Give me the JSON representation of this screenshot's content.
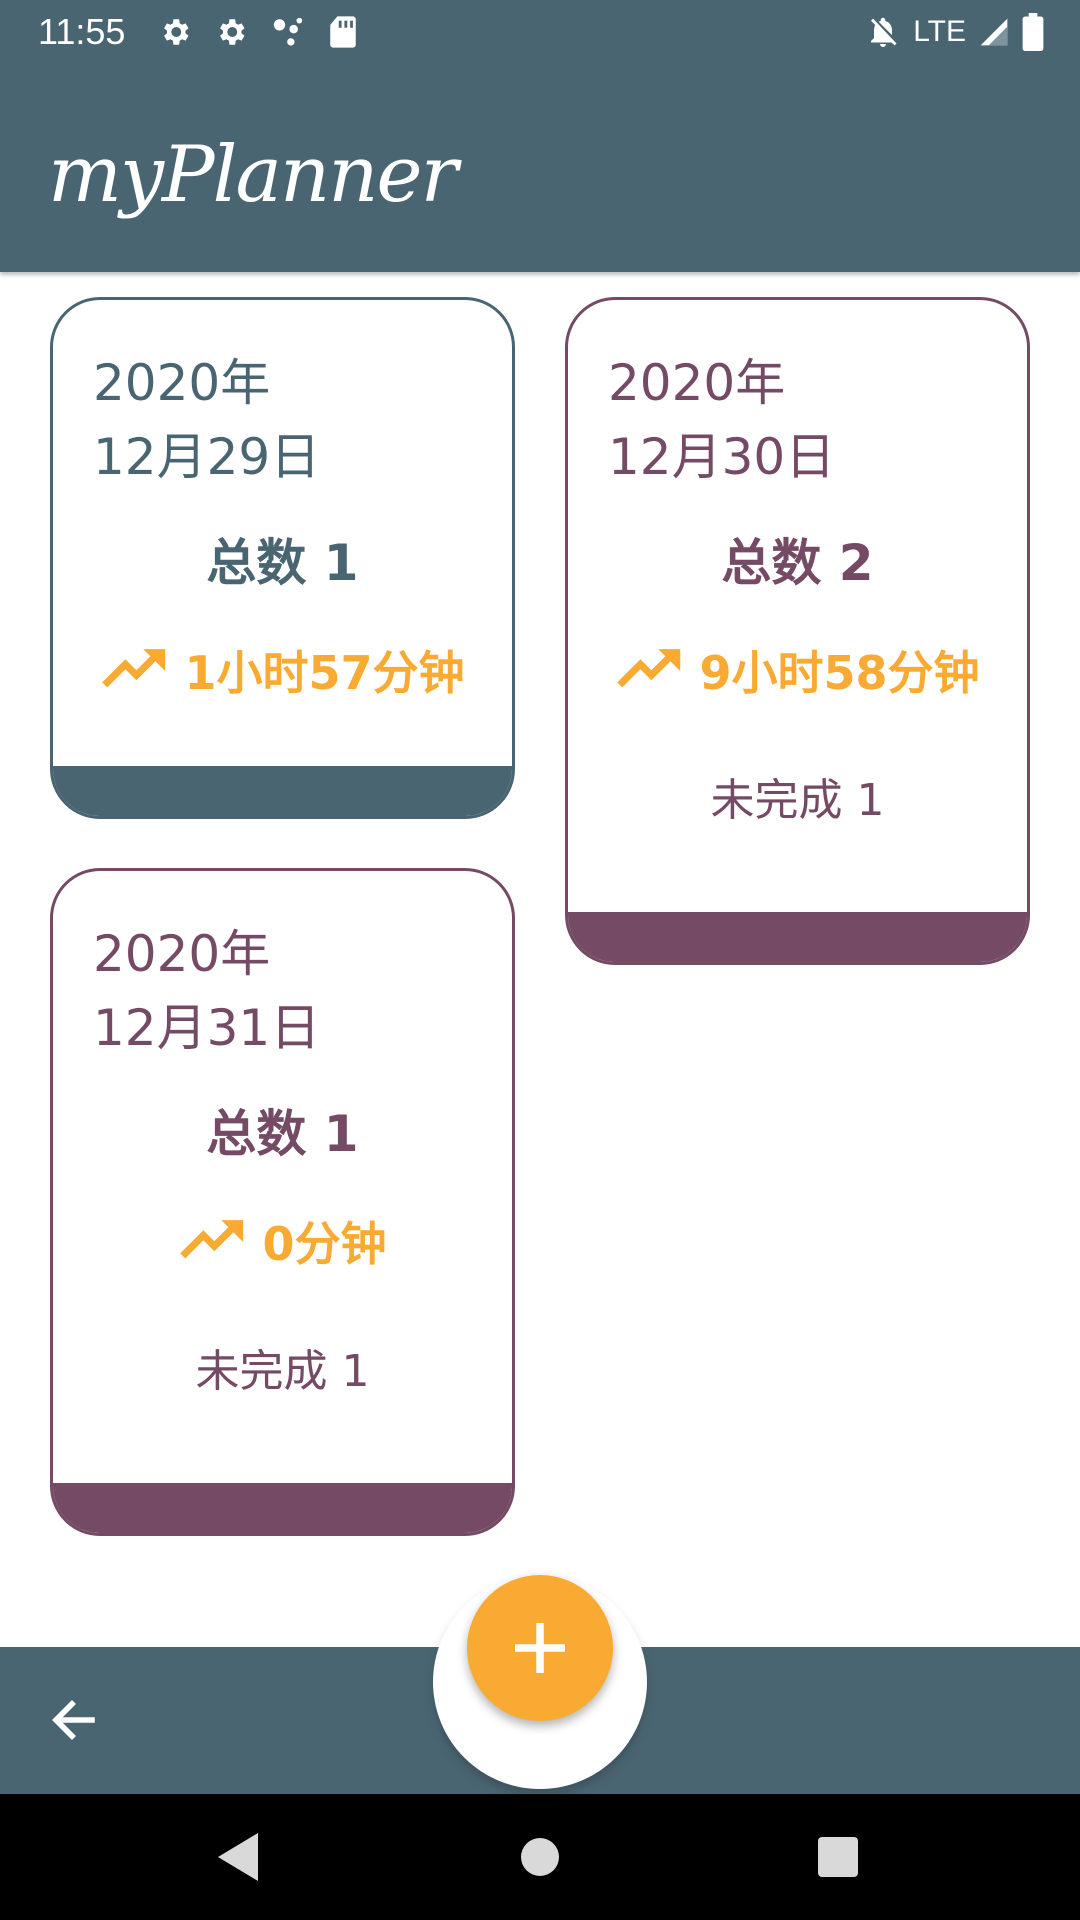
{
  "status_bar": {
    "time": "11:55",
    "network": "LTE",
    "icons_left": [
      "settings-icon",
      "settings-icon",
      "assistant-dots-icon",
      "sd-card-icon"
    ],
    "icons_right": [
      "notifications-off-icon",
      "signal-icon",
      "battery-icon"
    ]
  },
  "app_bar": {
    "title": "myPlanner"
  },
  "colors": {
    "primary": "#4a6572",
    "secondary": "#744a65",
    "accent": "#f9aa33",
    "background": "#ffffff"
  },
  "cards": [
    {
      "date_year": "2020年",
      "date_day": "12月29日",
      "total": "总数 1",
      "duration": "1小时57分钟",
      "incomplete": "",
      "color": "#4a6572"
    },
    {
      "date_year": "2020年",
      "date_day": "12月30日",
      "total": "总数 2",
      "duration": "9小时58分钟",
      "incomplete": "未完成 1",
      "color": "#744a65"
    },
    {
      "date_year": "2020年",
      "date_day": "12月31日",
      "total": "总数 1",
      "duration": "0分钟",
      "incomplete": "未完成 1",
      "color": "#744a65"
    }
  ],
  "bottom_bar": {
    "back_icon": "arrow-back-icon",
    "fab_icon": "add-icon"
  },
  "nav_bar": {
    "icons": [
      "nav-back-icon",
      "nav-home-icon",
      "nav-recents-icon"
    ]
  }
}
